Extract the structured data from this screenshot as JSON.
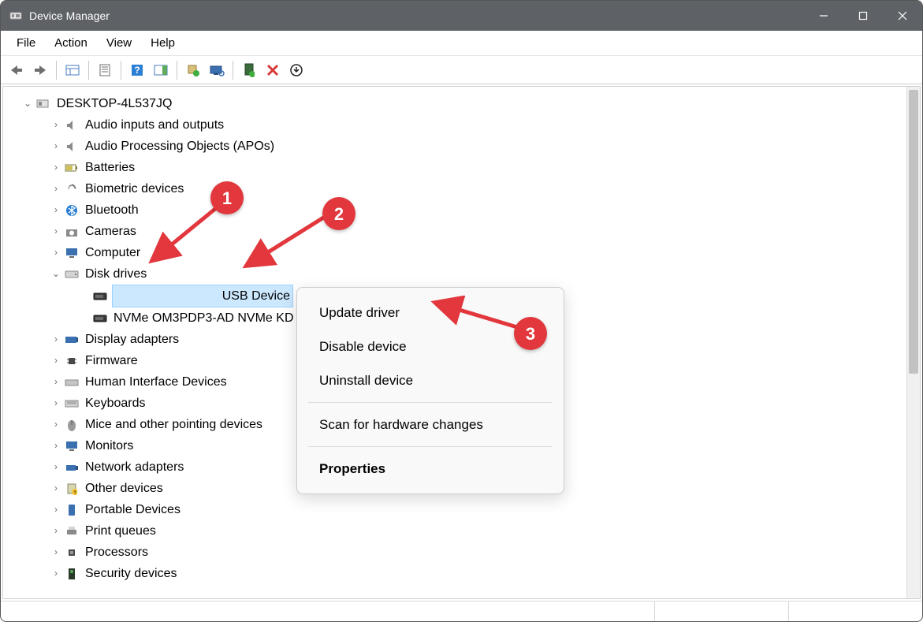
{
  "title": "Device Manager",
  "menus": [
    "File",
    "Action",
    "View",
    "Help"
  ],
  "root": "DESKTOP-4L537JQ",
  "categories": [
    "Audio inputs and outputs",
    "Audio Processing Objects (APOs)",
    "Batteries",
    "Biometric devices",
    "Bluetooth",
    "Cameras",
    "Computer",
    "Disk drives",
    "Display adapters",
    "Firmware",
    "Human Interface Devices",
    "Keyboards",
    "Mice and other pointing devices",
    "Monitors",
    "Network adapters",
    "Other devices",
    "Portable Devices",
    "Print queues",
    "Processors",
    "Security devices"
  ],
  "disk_children": {
    "selected": "USB Device",
    "other": "NVMe OM3PDP3-AD NVMe KD"
  },
  "context_menu": {
    "update": "Update driver",
    "disable": "Disable device",
    "uninstall": "Uninstall device",
    "scan": "Scan for hardware changes",
    "properties": "Properties"
  },
  "annotations": {
    "b1": "1",
    "b2": "2",
    "b3": "3"
  }
}
